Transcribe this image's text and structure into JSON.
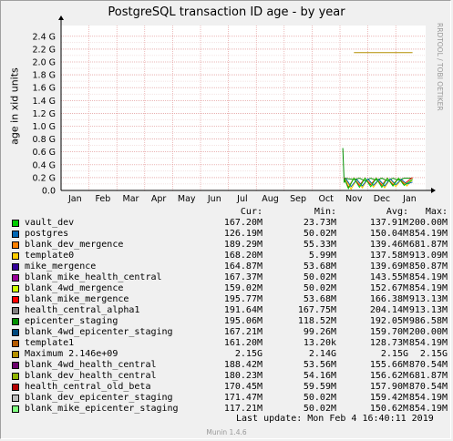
{
  "title": "PostgreSQL transaction ID age - by year",
  "vendor": "RRDTOOL / TOBI OETIKER",
  "munin": "Munin 1.4.6",
  "last_update": "Last update:  Mon Feb  4 16:40:11 2019",
  "legend_header": {
    "cur": "Cur:",
    "min": "Min:",
    "avg": "Avg:",
    "max": "Max:"
  },
  "legend": [
    {
      "name": "vault_dev",
      "color": "#00cc00",
      "cur": "167.20M",
      "min": "23.73M",
      "avg": "137.91M",
      "max": "200.00M"
    },
    {
      "name": "postgres",
      "color": "#0066b3",
      "cur": "126.19M",
      "min": "50.02M",
      "avg": "150.04M",
      "max": "854.19M"
    },
    {
      "name": "blank_dev_mergence",
      "color": "#ff8000",
      "cur": "189.29M",
      "min": "55.33M",
      "avg": "139.46M",
      "max": "681.87M"
    },
    {
      "name": "template0",
      "color": "#ffcc00",
      "cur": "168.20M",
      "min": "5.99M",
      "avg": "137.58M",
      "max": "913.09M"
    },
    {
      "name": "mike_mergence",
      "color": "#330099",
      "cur": "164.87M",
      "min": "53.68M",
      "avg": "139.69M",
      "max": "850.87M"
    },
    {
      "name": "blank_mike_health_central",
      "color": "#990099",
      "cur": "167.37M",
      "min": "50.02M",
      "avg": "143.55M",
      "max": "854.19M"
    },
    {
      "name": "blank_4wd_mergence",
      "color": "#ccff00",
      "cur": "159.02M",
      "min": "50.02M",
      "avg": "152.67M",
      "max": "854.19M"
    },
    {
      "name": "blank_mike_mergence",
      "color": "#ff0000",
      "cur": "195.77M",
      "min": "53.68M",
      "avg": "166.38M",
      "max": "913.13M"
    },
    {
      "name": "health_central_alpha1",
      "color": "#808080",
      "cur": "191.64M",
      "min": "167.75M",
      "avg": "204.14M",
      "max": "913.13M"
    },
    {
      "name": "epicenter_staging",
      "color": "#008f00",
      "cur": "195.06M",
      "min": "118.52M",
      "avg": "192.05M",
      "max": "986.58M"
    },
    {
      "name": "blank_4wd_epicenter_staging",
      "color": "#00487d",
      "cur": "167.21M",
      "min": "99.26M",
      "avg": "159.70M",
      "max": "200.00M"
    },
    {
      "name": "template1",
      "color": "#b35a00",
      "cur": "161.20M",
      "min": "13.20k",
      "avg": "128.73M",
      "max": "854.19M"
    },
    {
      "name": "Maximum 2.146e+09",
      "color": "#b38f00",
      "cur": "2.15G",
      "min": "2.14G",
      "avg": "2.15G",
      "max": "2.15G"
    },
    {
      "name": "blank_4wd_health_central",
      "color": "#6b006b",
      "cur": "188.42M",
      "min": "53.56M",
      "avg": "155.66M",
      "max": "870.54M"
    },
    {
      "name": "blank_dev_health_central",
      "color": "#8fb300",
      "cur": "180.23M",
      "min": "54.16M",
      "avg": "156.62M",
      "max": "681.87M"
    },
    {
      "name": "health_central_old_beta",
      "color": "#b30000",
      "cur": "170.45M",
      "min": "59.59M",
      "avg": "157.90M",
      "max": "870.54M"
    },
    {
      "name": "blank_dev_epicenter_staging",
      "color": "#bebebe",
      "cur": "171.47M",
      "min": "50.02M",
      "avg": "159.42M",
      "max": "854.19M"
    },
    {
      "name": "blank_mike_epicenter_staging",
      "color": "#80ff80",
      "cur": "117.21M",
      "min": "50.02M",
      "avg": "150.62M",
      "max": "854.19M"
    }
  ],
  "chart_data": {
    "type": "line",
    "title": "PostgreSQL transaction ID age - by year",
    "ylabel": "age in xid units",
    "ylim": [
      0,
      2.5
    ],
    "y_ticks": [
      "0.0",
      "0.2 G",
      "0.4 G",
      "0.6 G",
      "0.8 G",
      "1.0 G",
      "1.2 G",
      "1.4 G",
      "1.6 G",
      "1.8 G",
      "2.0 G",
      "2.2 G",
      "2.4 G"
    ],
    "x_ticks": [
      "Jan",
      "Feb",
      "Mar",
      "Apr",
      "May",
      "Jun",
      "Jul",
      "Aug",
      "Sep",
      "Oct",
      "Nov",
      "Dec",
      "Jan"
    ],
    "grid": true,
    "series": [
      {
        "name": "Maximum 2.146e+09",
        "color": "#b38f00",
        "x": [
          10.5,
          12.6
        ],
        "y": [
          2.146,
          2.146
        ]
      },
      {
        "name": "epicenter_staging",
        "color": "#008f00",
        "x": [
          10.1,
          10.15,
          10.2,
          10.3,
          10.5,
          10.7,
          10.9,
          11.1,
          11.3,
          11.5,
          11.7,
          11.9,
          12.1,
          12.3,
          12.6
        ],
        "y": [
          0.66,
          0.12,
          0.19,
          0.18,
          0.17,
          0.19,
          0.15,
          0.19,
          0.16,
          0.19,
          0.15,
          0.19,
          0.16,
          0.19,
          0.19
        ]
      },
      {
        "name": "blank_mike_mergence",
        "color": "#ff0000",
        "x": [
          10.15,
          10.3,
          10.5,
          10.7,
          10.9,
          11.1,
          11.3,
          11.5,
          11.7,
          11.9,
          12.1,
          12.3,
          12.6
        ],
        "y": [
          0.2,
          0.05,
          0.19,
          0.08,
          0.19,
          0.09,
          0.19,
          0.08,
          0.19,
          0.09,
          0.19,
          0.1,
          0.2
        ]
      },
      {
        "name": "template0",
        "color": "#ffcc00",
        "x": [
          10.2,
          10.4,
          10.6,
          10.8,
          11.0,
          11.2,
          11.4,
          11.6,
          11.8,
          12.0,
          12.2,
          12.4,
          12.6
        ],
        "y": [
          0.18,
          0.02,
          0.17,
          0.04,
          0.18,
          0.05,
          0.17,
          0.04,
          0.18,
          0.06,
          0.17,
          0.07,
          0.17
        ]
      },
      {
        "name": "postgres",
        "color": "#0066b3",
        "x": [
          10.2,
          10.4,
          10.6,
          10.8,
          11.0,
          11.2,
          11.4,
          11.6,
          11.8,
          12.0,
          12.2,
          12.4,
          12.6
        ],
        "y": [
          0.19,
          0.06,
          0.17,
          0.07,
          0.18,
          0.08,
          0.17,
          0.07,
          0.18,
          0.09,
          0.17,
          0.1,
          0.13
        ]
      },
      {
        "name": "vault_dev",
        "color": "#00cc00",
        "x": [
          10.15,
          10.3,
          10.5,
          10.7,
          10.9,
          11.1,
          11.3,
          11.5,
          11.7,
          11.9,
          12.1,
          12.3,
          12.6
        ],
        "y": [
          0.19,
          0.03,
          0.19,
          0.05,
          0.19,
          0.06,
          0.19,
          0.05,
          0.19,
          0.07,
          0.19,
          0.08,
          0.17
        ]
      }
    ]
  }
}
